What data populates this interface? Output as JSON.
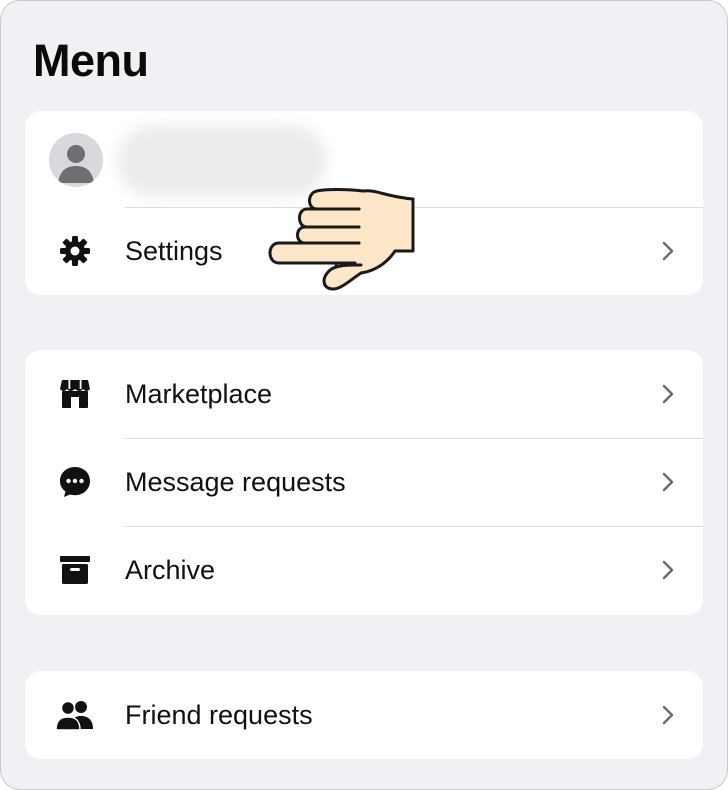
{
  "header": {
    "title": "Menu"
  },
  "profile": {
    "avatar_icon": "person-silhouette-icon",
    "name_redacted": true
  },
  "groups": [
    {
      "items": [
        {
          "label": "Settings",
          "icon": "gear-icon",
          "chevron": "chevron-right-icon"
        }
      ]
    },
    {
      "items": [
        {
          "label": "Marketplace",
          "icon": "storefront-icon",
          "chevron": "chevron-right-icon"
        },
        {
          "label": "Message requests",
          "icon": "chat-bubble-icon",
          "chevron": "chevron-right-icon"
        },
        {
          "label": "Archive",
          "icon": "archive-box-icon",
          "chevron": "chevron-right-icon"
        }
      ]
    },
    {
      "items": [
        {
          "label": "Friend requests",
          "icon": "friends-icon",
          "chevron": "chevron-right-icon"
        }
      ]
    }
  ],
  "overlay": {
    "icon": "pointing-hand-icon",
    "points_to": "Settings"
  },
  "colors": {
    "background": "#f0f1f5",
    "card": "#ffffff",
    "text": "#111111",
    "icon": "#111111",
    "chevron": "#6b6b70",
    "divider": "#dcdcdf",
    "hand_fill": "#fde7c8"
  }
}
